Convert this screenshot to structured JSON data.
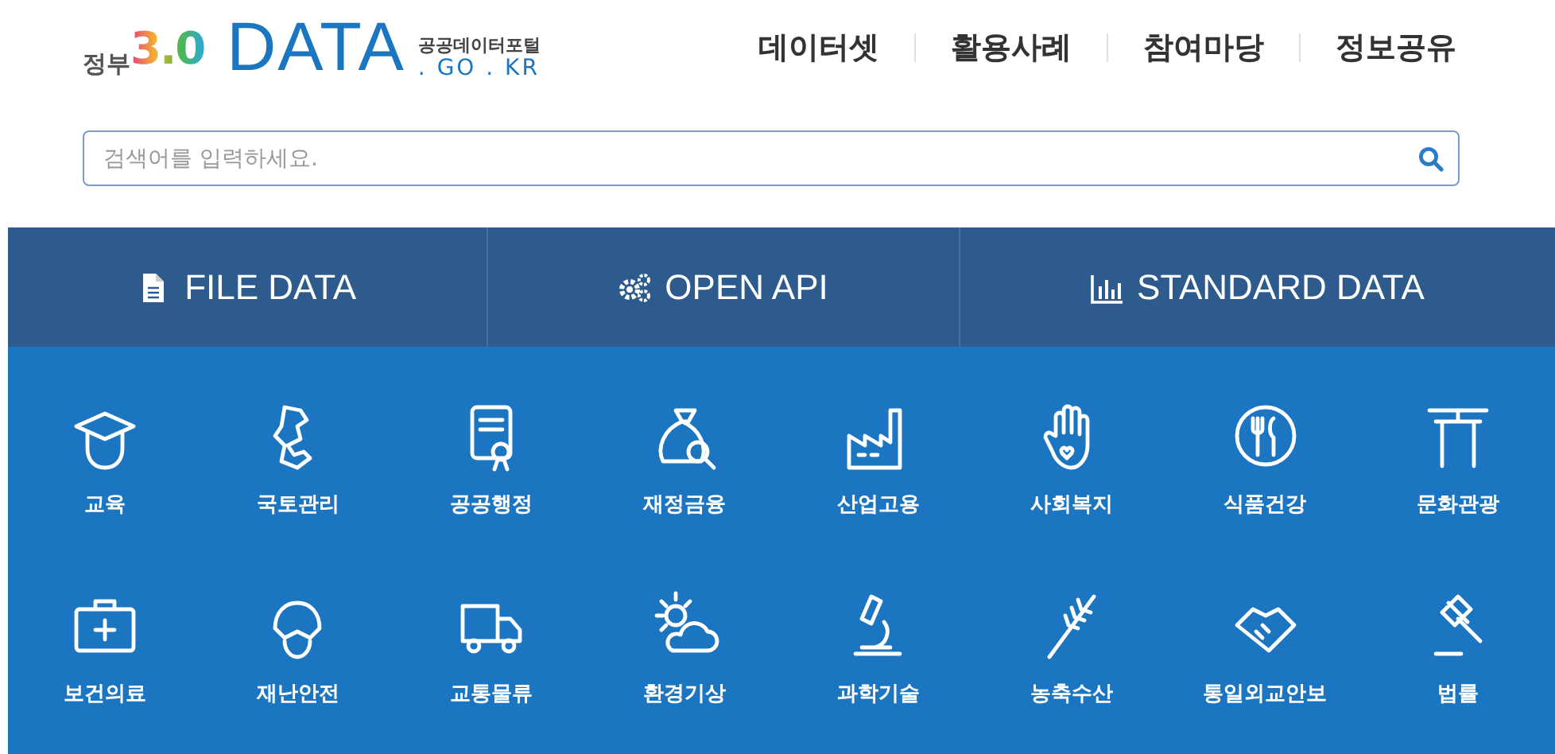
{
  "logo": {
    "prefix": "정부",
    "version": "3.0",
    "brand": "DATA",
    "subtitle": "공공데이터포털",
    "domain": ". GO . KR"
  },
  "nav": [
    "데이터셋",
    "활용사례",
    "참여마당",
    "정보공유"
  ],
  "search": {
    "placeholder": "검색어를 입력하세요."
  },
  "tabs": [
    {
      "label": "FILE DATA",
      "kind": "file"
    },
    {
      "label": "OPEN API",
      "kind": "api"
    },
    {
      "label": "STANDARD DATA",
      "kind": "chart"
    }
  ],
  "categories": [
    "교육",
    "국토관리",
    "공공행정",
    "재정금융",
    "산업고용",
    "사회복지",
    "식품건강",
    "문화관광",
    "보건의료",
    "재난안전",
    "교통물류",
    "환경기상",
    "과학기술",
    "농축수산",
    "통일외교안보",
    "법률"
  ]
}
